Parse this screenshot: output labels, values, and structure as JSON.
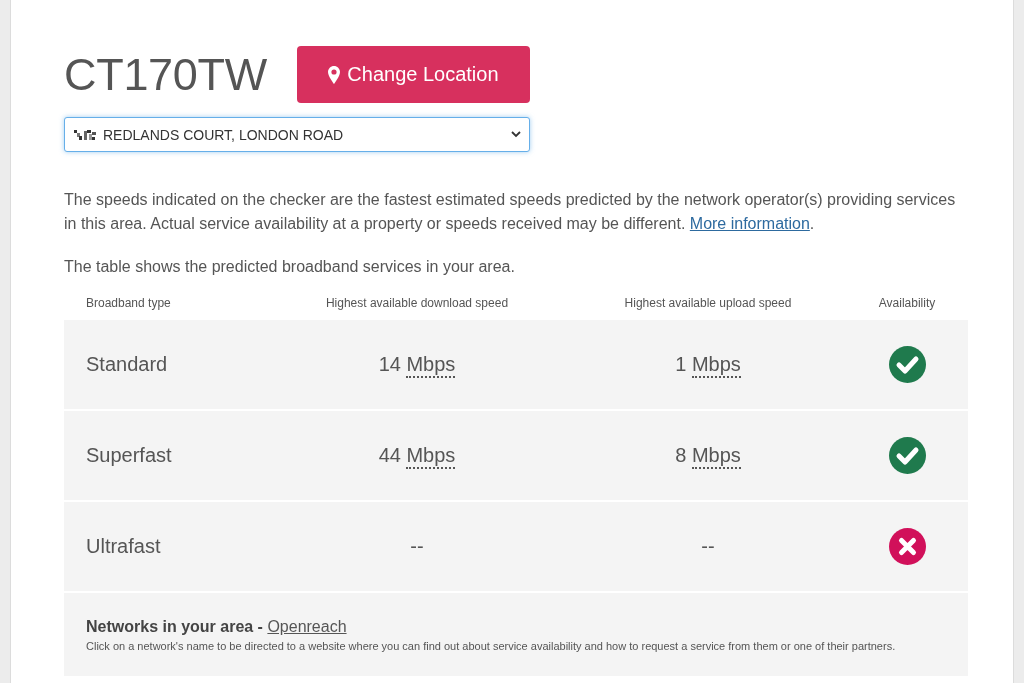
{
  "header": {
    "postcode": "CT170TW",
    "change_location_button": "Change Location"
  },
  "address_select": {
    "value": "REDLANDS COURT, LONDON ROAD"
  },
  "disclaimer": {
    "text": "The speeds indicated on the checker are the fastest estimated speeds predicted by the network operator(s) providing services in this area. Actual service availability at a property or speeds received may be different.",
    "link": "More information",
    "after_link": "."
  },
  "table_intro": "The table shows the predicted broadband services in your area.",
  "table": {
    "columns": [
      "Broadband type",
      "Highest available download speed",
      "Highest available upload speed",
      "Availability"
    ],
    "rows": [
      {
        "type": "Standard",
        "download": {
          "value": "14",
          "unit": "Mbps"
        },
        "upload": {
          "value": "1",
          "unit": "Mbps"
        },
        "available": true
      },
      {
        "type": "Superfast",
        "download": {
          "value": "44",
          "unit": "Mbps"
        },
        "upload": {
          "value": "8",
          "unit": "Mbps"
        },
        "available": true
      },
      {
        "type": "Ultrafast",
        "download": {
          "value": "--"
        },
        "upload": {
          "value": "--"
        },
        "available": false
      }
    ]
  },
  "networks": {
    "heading": "Networks in your area -",
    "link": "Openreach",
    "note": "Click on a network's name to be directed to a website where you can find out about service availability and how to request a service from them or one of their partners."
  }
}
